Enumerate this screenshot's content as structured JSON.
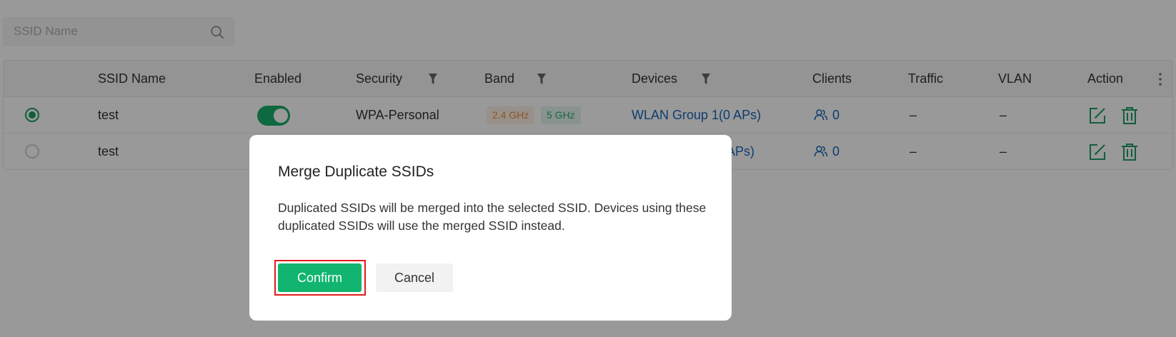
{
  "search": {
    "placeholder": "SSID Name"
  },
  "table": {
    "headers": {
      "ssid_name": "SSID Name",
      "enabled": "Enabled",
      "security": "Security",
      "band": "Band",
      "devices": "Devices",
      "clients": "Clients",
      "traffic": "Traffic",
      "vlan": "VLAN",
      "action": "Action"
    },
    "rows": [
      {
        "selected": true,
        "ssid_name": "test",
        "enabled": true,
        "security": "WPA-Personal",
        "band_24": "2.4 GHz",
        "band_5": "5 GHz",
        "devices": "WLAN Group 1(0 APs)",
        "clients": "0",
        "traffic": "–",
        "vlan": "–"
      },
      {
        "selected": false,
        "ssid_name": "test",
        "devices": "APs)",
        "clients": "0",
        "traffic": "–",
        "vlan": "–"
      }
    ]
  },
  "modal": {
    "title": "Merge Duplicate SSIDs",
    "body": "Duplicated SSIDs will be merged into the selected SSID. Devices using these duplicated SSIDs will use the merged SSID instead.",
    "confirm_label": "Confirm",
    "cancel_label": "Cancel"
  },
  "colors": {
    "primary_green": "#11b56f",
    "link_blue": "#1a66b8",
    "band_24": "#ef8a38",
    "band_5": "#2aae6e",
    "highlight": "#e01b1b"
  },
  "icons": [
    "search-icon",
    "filter-icon",
    "more-vertical-icon",
    "users-icon",
    "edit-icon",
    "delete-icon"
  ]
}
